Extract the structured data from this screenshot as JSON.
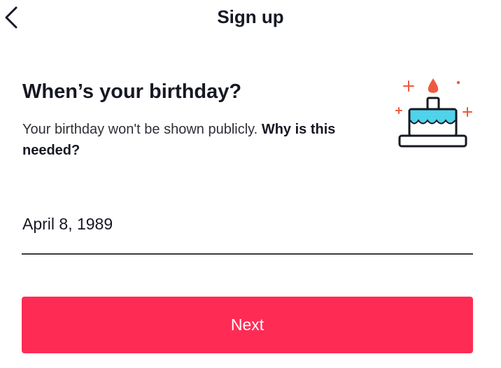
{
  "header": {
    "title": "Sign up",
    "back_icon": "chevron-left-icon"
  },
  "main": {
    "heading": "When’s your birthday?",
    "subtext": "Your birthday won't be shown publicly.",
    "why_link": "Why is this needed?",
    "illustration_icon": "birthday-cake-icon",
    "birthday_value": "April 8, 1989"
  },
  "footer": {
    "next_label": "Next"
  },
  "colors": {
    "accent": "#fe2c55",
    "cake_frosting": "#4fd3ea",
    "candle_flame": "#ee5a40",
    "text": "#161823"
  }
}
